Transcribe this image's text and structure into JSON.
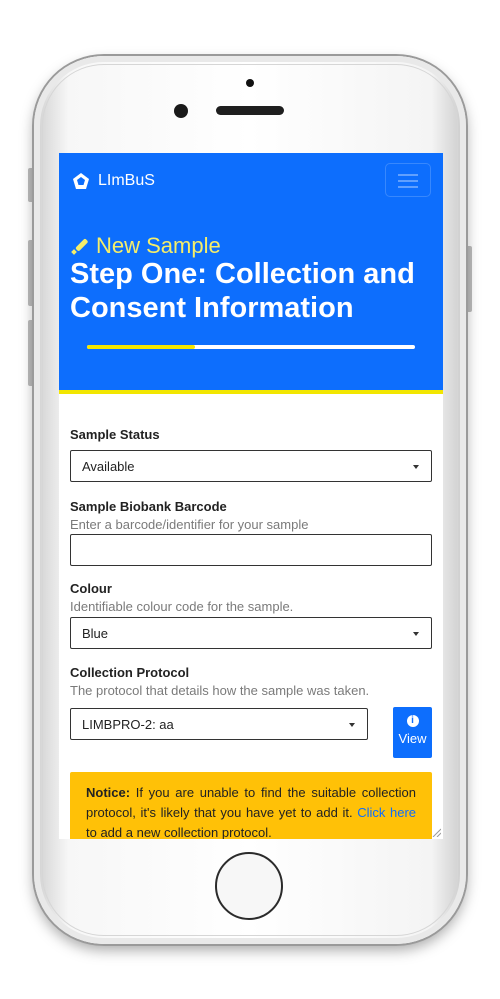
{
  "app": {
    "brand": "LImBuS"
  },
  "hero": {
    "kicker": "New Sample",
    "title": "Step One: Collection and Consent Information",
    "progress_fraction": 0.33
  },
  "form": {
    "sample_status": {
      "label": "Sample Status",
      "value": "Available"
    },
    "barcode": {
      "label": "Sample Biobank Barcode",
      "help": "Enter a barcode/identifier for your sample",
      "value": ""
    },
    "colour": {
      "label": "Colour",
      "help": "Identifiable colour code for the sample.",
      "value": "Blue"
    },
    "protocol": {
      "label": "Collection Protocol",
      "help": "The protocol that details how the sample was taken.",
      "value": "LIMBPRO-2: aa",
      "view_label": "View"
    }
  },
  "notice": {
    "title": "Notice:",
    "text_before": " If you are unable to find the suitable collection protocol, it's likely that you have yet to add it. ",
    "link": "Click here",
    "text_after": " to add a new collection protocol."
  },
  "colors": {
    "primary": "#0d6efd",
    "accent_yellow": "#f2e600",
    "notice_bg": "#ffc107"
  }
}
